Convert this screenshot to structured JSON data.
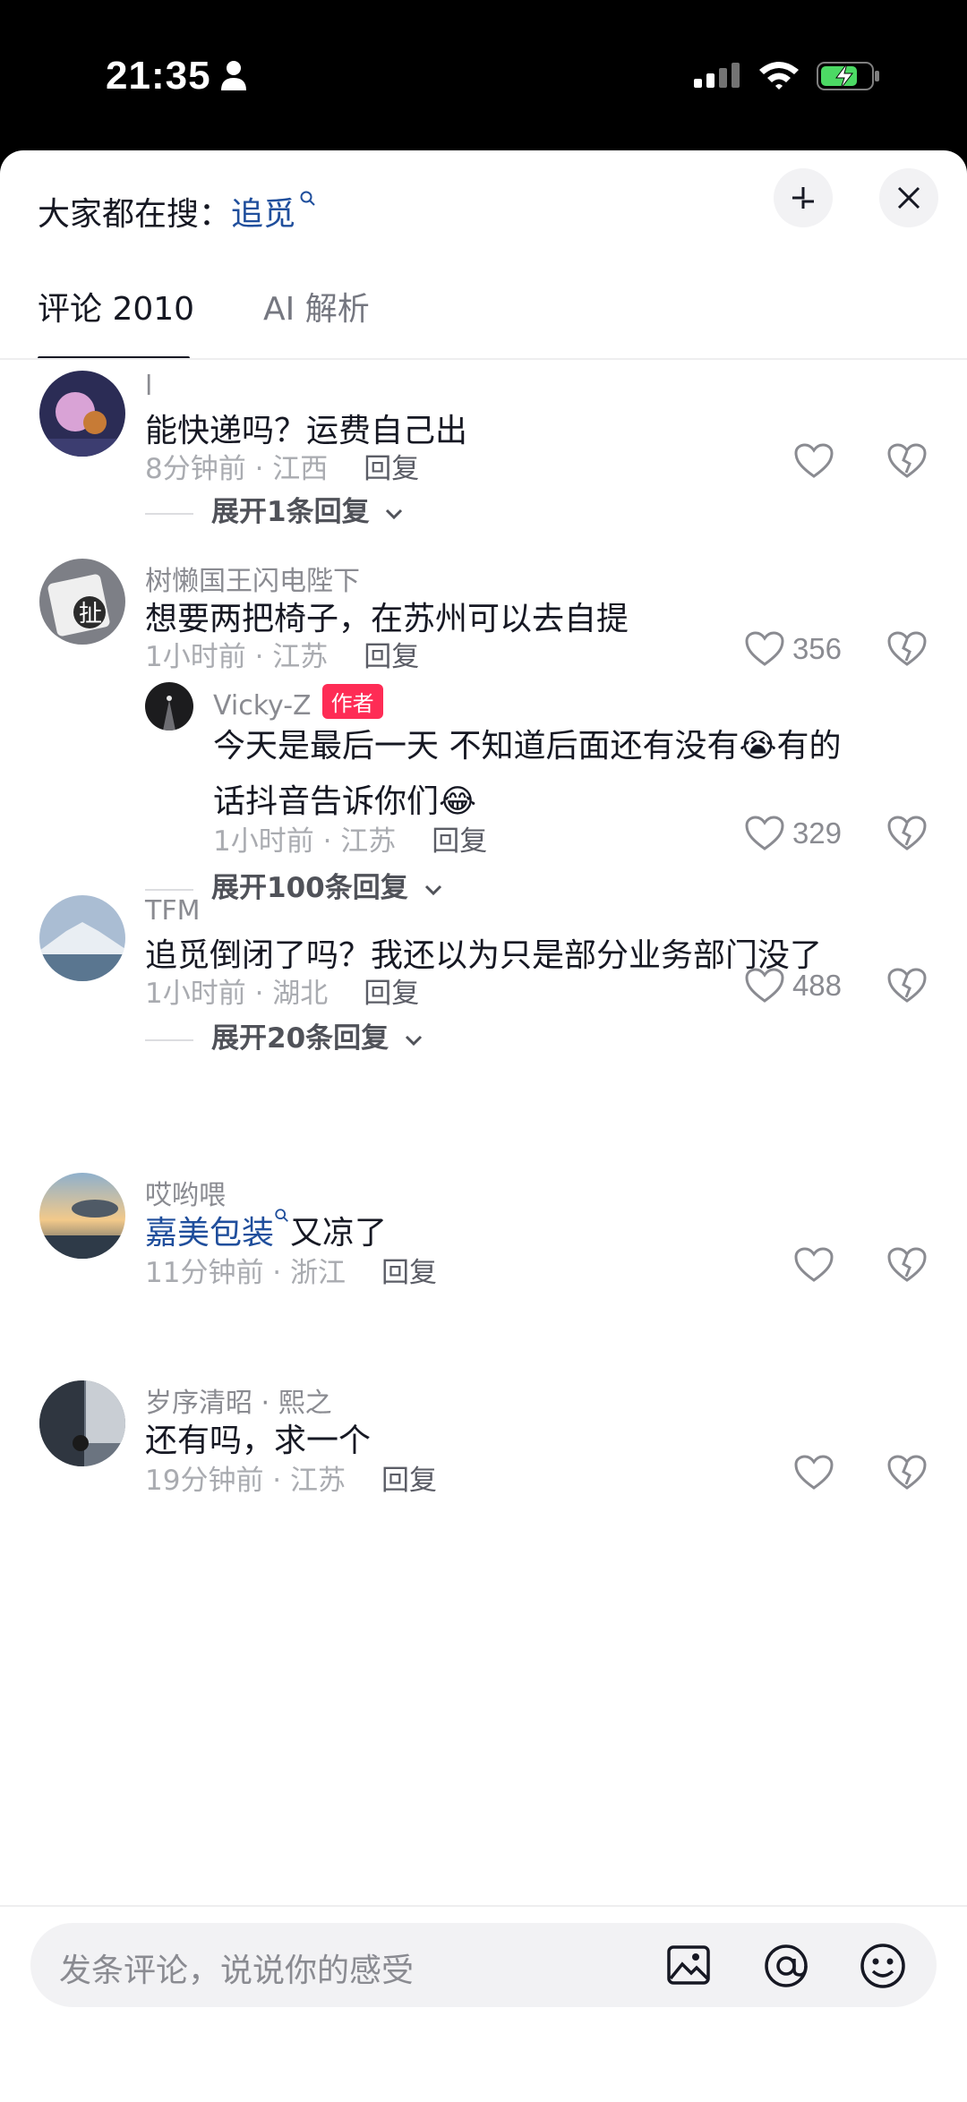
{
  "status_bar": {
    "time": "21:35"
  },
  "header": {
    "hot_prefix": "大家都在搜：",
    "hot_keyword": "追觅"
  },
  "tabs": [
    {
      "label": "评论 2010",
      "active": true
    },
    {
      "label": "AI 解析",
      "active": false
    }
  ],
  "comments": [
    {
      "user": "l",
      "text": "能快递吗？运费自己出",
      "time": "8分钟前",
      "location": "江西",
      "reply_label": "回复",
      "likes": "",
      "expand": "展开1条回复"
    },
    {
      "user": "树懒国王闪电陛下",
      "text": "想要两把椅子，在苏州可以去自提",
      "time": "1小时前",
      "location": "江苏",
      "reply_label": "回复",
      "likes": "356",
      "reply": {
        "user": "Vicky-Z",
        "badge": "作者",
        "line1": "今天是最后一天 不知道后面还有没有😭有的",
        "line2": "话抖音告诉你们😂",
        "time": "1小时前",
        "location": "江苏",
        "reply_label": "回复",
        "likes": "329"
      },
      "expand": "展开100条回复"
    },
    {
      "user": "TFM",
      "text": "追觅倒闭了吗？我还以为只是部分业务部门没了",
      "time": "1小时前",
      "location": "湖北",
      "reply_label": "回复",
      "likes": "488",
      "expand": "展开20条回复"
    },
    {
      "user": "哎哟喂",
      "keyword": "嘉美包装",
      "text": "又凉了",
      "time": "11分钟前",
      "location": "浙江",
      "reply_label": "回复",
      "likes": ""
    },
    {
      "user": "岁序清昭 · 熙之",
      "text": "还有吗，求一个",
      "time": "19分钟前",
      "location": "江苏",
      "reply_label": "回复",
      "likes": ""
    },
    {
      "user": "-------"
    }
  ],
  "meta_separator": " · ",
  "bottom_bar": {
    "placeholder": "发条评论，说说你的感受"
  },
  "icons": [
    "person-icon",
    "signal-icon",
    "wifi-icon",
    "battery-charging-icon",
    "search-icon",
    "collapse-icon",
    "close-icon",
    "heart-icon",
    "broken-heart-icon",
    "chevron-down-icon",
    "image-icon",
    "at-icon",
    "emoji-icon"
  ],
  "colors": {
    "link": "#1f4e9c",
    "author_badge": "#fe2c55",
    "meta": "#a9abb0"
  }
}
